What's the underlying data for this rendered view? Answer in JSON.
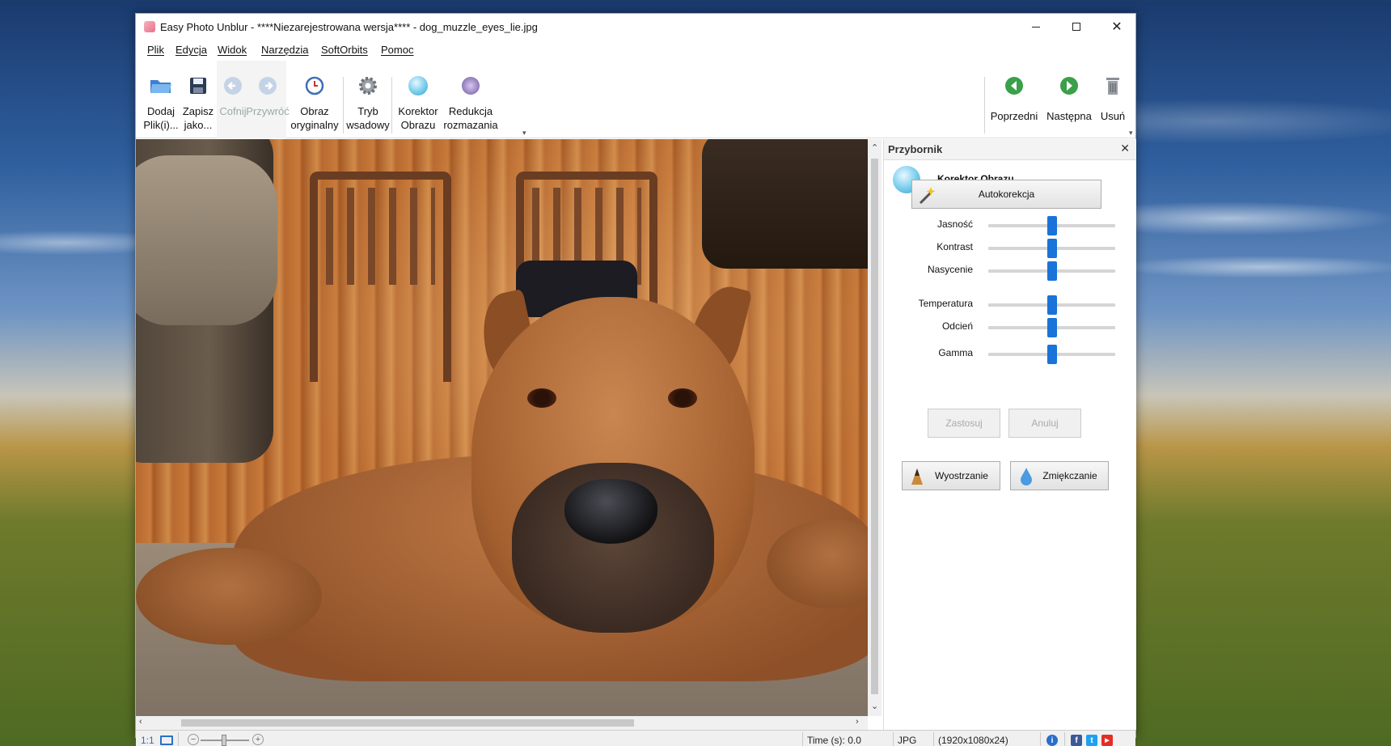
{
  "window": {
    "title": "Easy Photo Unblur - ****Niezarejestrowana wersja**** - dog_muzzle_eyes_lie.jpg",
    "minimize_icon": "minimize-icon",
    "maximize_icon": "maximize-icon",
    "close_icon": "close-icon"
  },
  "menu": {
    "items": [
      "Plik",
      "Edycja",
      "Widok",
      "Narzędzia",
      "SoftOrbits",
      "Pomoc"
    ]
  },
  "toolbar": {
    "add": "Dodaj\nPlik(i)...",
    "save": "Zapisz\njako...",
    "undo": "Cofnij",
    "redo": "Przywróć",
    "original": "Obraz\noryginalny",
    "batch": "Tryb\nwsadowy",
    "corrector": "Korektor\nObrazu",
    "deblur": "Redukcja\nrozmazania",
    "previous": "Poprzedni",
    "next": "Następna",
    "delete": "Usuń"
  },
  "panel": {
    "title": "Przybornik",
    "tool_title": "Korektor Obrazu",
    "autocorrect": "Autokorekcja",
    "sliders": [
      {
        "label": "Jasność",
        "value": 0.5
      },
      {
        "label": "Kontrast",
        "value": 0.5
      },
      {
        "label": "Nasycenie",
        "value": 0.5
      },
      {
        "label": "Temperatura",
        "value": 0.5
      },
      {
        "label": "Odcień",
        "value": 0.5
      },
      {
        "label": "Gamma",
        "value": 0.5
      }
    ],
    "apply": "Zastosuj",
    "cancel": "Anuluj",
    "sharpen": "Wyostrzanie",
    "soften": "Zmiękczanie"
  },
  "status": {
    "zoom_ratio": "1:1",
    "time": "Time (s): 0.0",
    "format": "JPG",
    "dimensions": "(1920x1080x24)"
  },
  "colors": {
    "accent": "#1a73d8",
    "back_green": "#3aa04a"
  }
}
